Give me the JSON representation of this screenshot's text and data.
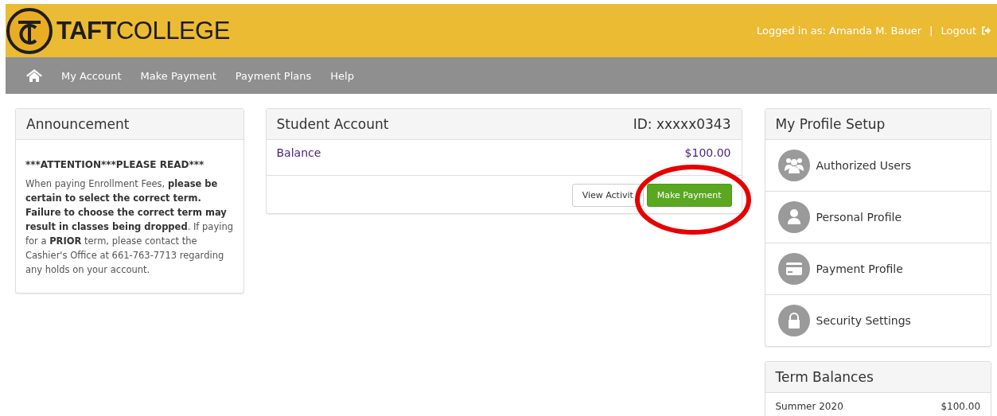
{
  "header": {
    "logo": "**TAFT**COLLEGE",
    "logged_in": "Logged in as: Amanda M. Bauer",
    "separator": "|",
    "logout": "Logout"
  },
  "nav": {
    "items": [
      {
        "label": "My Account"
      },
      {
        "label": "Make Payment"
      },
      {
        "label": "Payment Plans"
      },
      {
        "label": "Help"
      }
    ]
  },
  "announcement": {
    "title": "Announcement",
    "heading": "***ATTENTION***PLEASE READ***",
    "body": "When paying Enrollment Fees, **please be certain to select the correct term. Failure to choose the correct term may result in classes being dropped**. If paying for a **PRIOR** term, please contact the Cashier's Office at 661-763-7713 regarding any holds on your account."
  },
  "student_account": {
    "title": "Student Account",
    "id": "ID: xxxxx0343",
    "balance_label": "Balance",
    "balance": "$100.00",
    "buttons": [
      {
        "label": "View Activit",
        "kind": "default"
      },
      {
        "label": "Make Payment",
        "kind": "primary"
      }
    ]
  },
  "profile_setup": {
    "title": "My Profile Setup",
    "items": [
      {
        "label": "Authorized Users",
        "kind": "users"
      },
      {
        "label": "Personal Profile",
        "kind": "user"
      },
      {
        "label": "Payment Profile",
        "kind": "card"
      },
      {
        "label": "Security Settings",
        "kind": "lock"
      }
    ]
  },
  "term_balances": {
    "title": "Term Balances",
    "rows": [
      {
        "term": "Summer 2020",
        "amount": "$100.00"
      }
    ]
  }
}
